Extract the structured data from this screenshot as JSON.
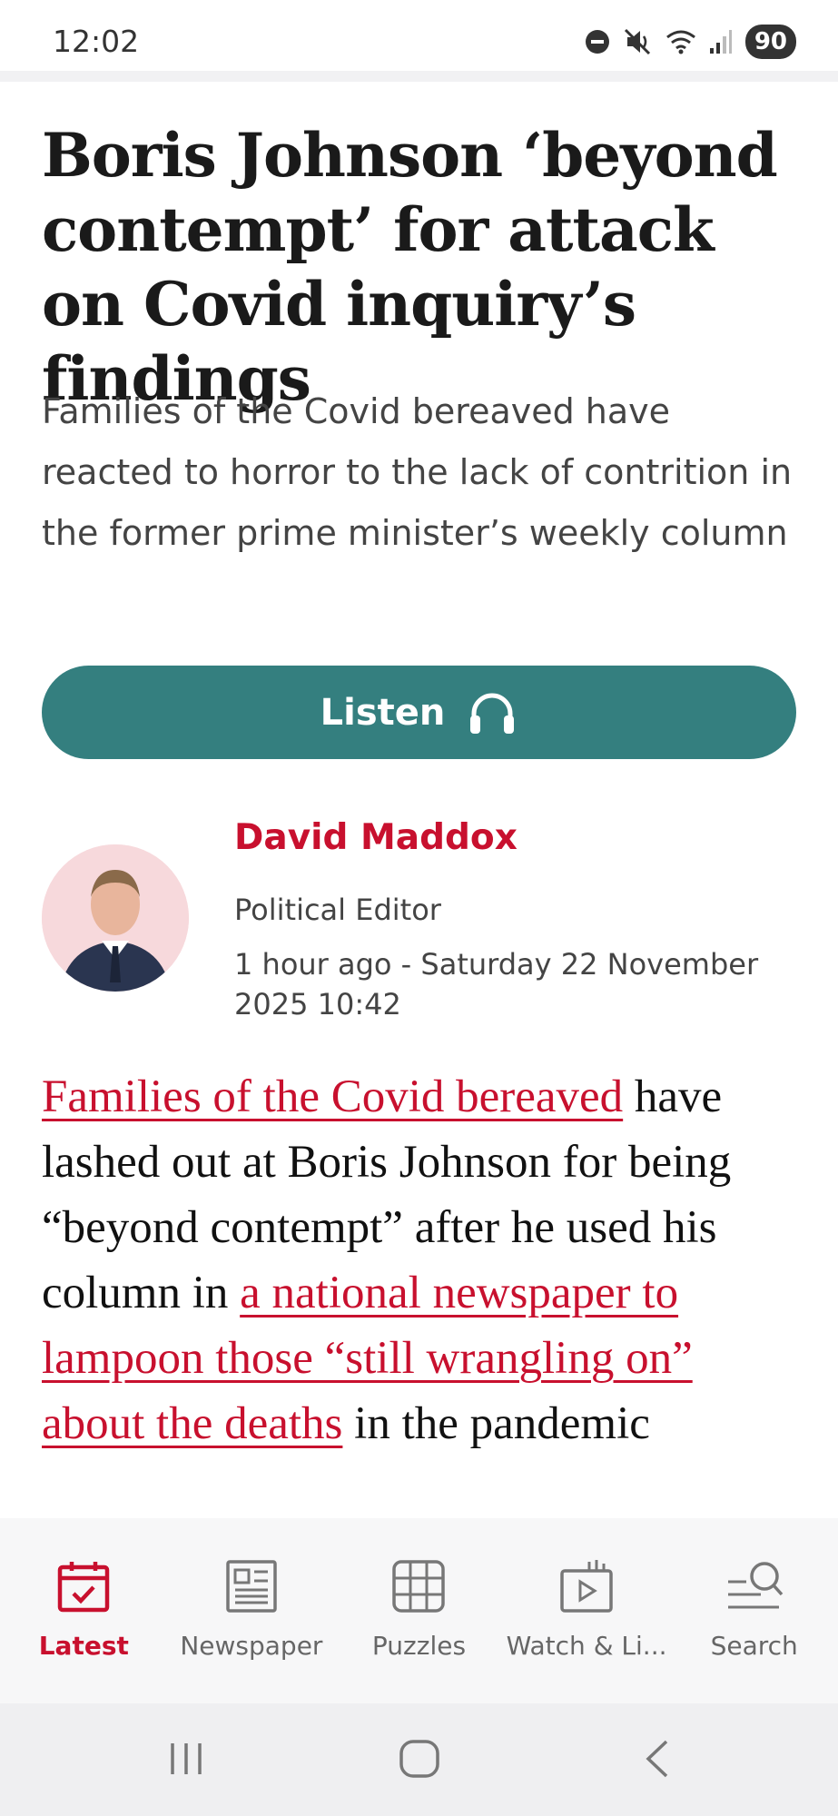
{
  "status_bar": {
    "time": "12:02",
    "battery": "90",
    "icons": [
      "do-not-disturb-icon",
      "mute-icon",
      "wifi-icon",
      "signal-icon"
    ]
  },
  "article": {
    "headline": "Boris Johnson ‘beyond contempt’ for attack on Covid inquiry’s findings",
    "standfirst": "Families of the Covid bereaved have reacted to horror to the lack of contrition in the former prime minister’s weekly column",
    "listen_label": "Listen",
    "author": {
      "name": "David Maddox",
      "role": "Political Editor",
      "timestamp": "1 hour ago - Saturday 22 November 2025 10:42"
    },
    "body": {
      "link1": "Families of the Covid bereaved",
      "text1": " have lashed out at Boris Johnson for being “beyond contempt” after he used his column in ",
      "link2": "a national newspaper to lampoon those “still wrangling on” about the deaths",
      "text2": " in the pandemic"
    }
  },
  "bottom_nav": {
    "items": [
      {
        "label": "Latest",
        "icon": "calendar-check-icon",
        "active": true
      },
      {
        "label": "Newspaper",
        "icon": "newspaper-icon",
        "active": false
      },
      {
        "label": "Puzzles",
        "icon": "grid-icon",
        "active": false
      },
      {
        "label": "Watch & Li...",
        "icon": "video-icon",
        "active": false
      },
      {
        "label": "Search",
        "icon": "search-icon",
        "active": false
      }
    ]
  },
  "colors": {
    "accent": "#c8102e",
    "listen_button": "#347f7f"
  }
}
